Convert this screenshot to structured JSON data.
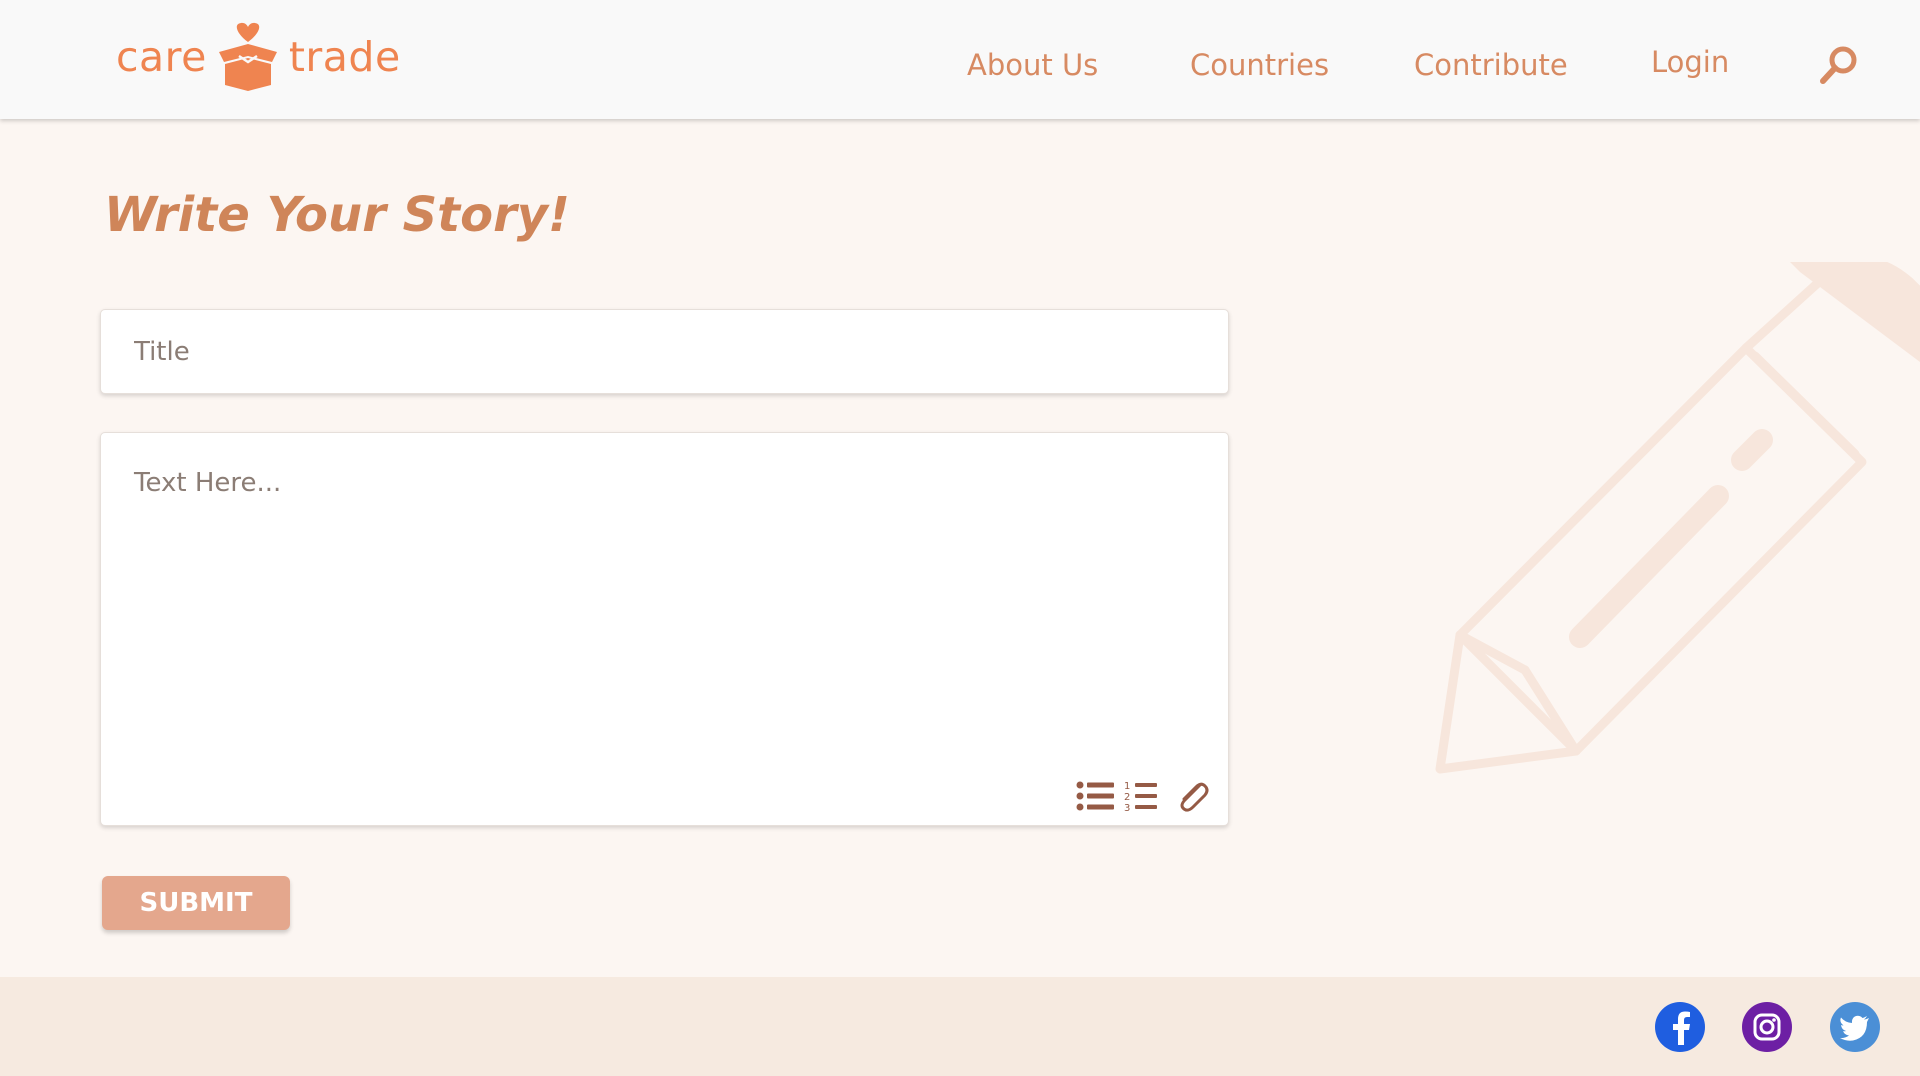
{
  "brand": {
    "left": "care",
    "right": "trade"
  },
  "nav": {
    "about": "About Us",
    "countries": "Countries",
    "contribute": "Contribute",
    "login": "Login"
  },
  "icons": {
    "search": "search-icon",
    "bullet_list": "bullet-list-icon",
    "numbered_list": "numbered-list-icon",
    "attach": "paperclip-icon",
    "facebook": "facebook-icon",
    "instagram": "instagram-icon",
    "twitter": "twitter-icon"
  },
  "colors": {
    "brand_orange": "#ef8450",
    "nav_text": "#d78a62",
    "title": "#cf8559",
    "submit_bg": "#e4a78d",
    "page_bg": "#fcf6f2",
    "footer_bg": "#f6eae0",
    "tool_icons": "#955a45"
  },
  "page": {
    "title": "Write Your Story!"
  },
  "form": {
    "title_placeholder": "Title",
    "text_placeholder": "Text Here...",
    "submit_label": "SUBMIT"
  }
}
